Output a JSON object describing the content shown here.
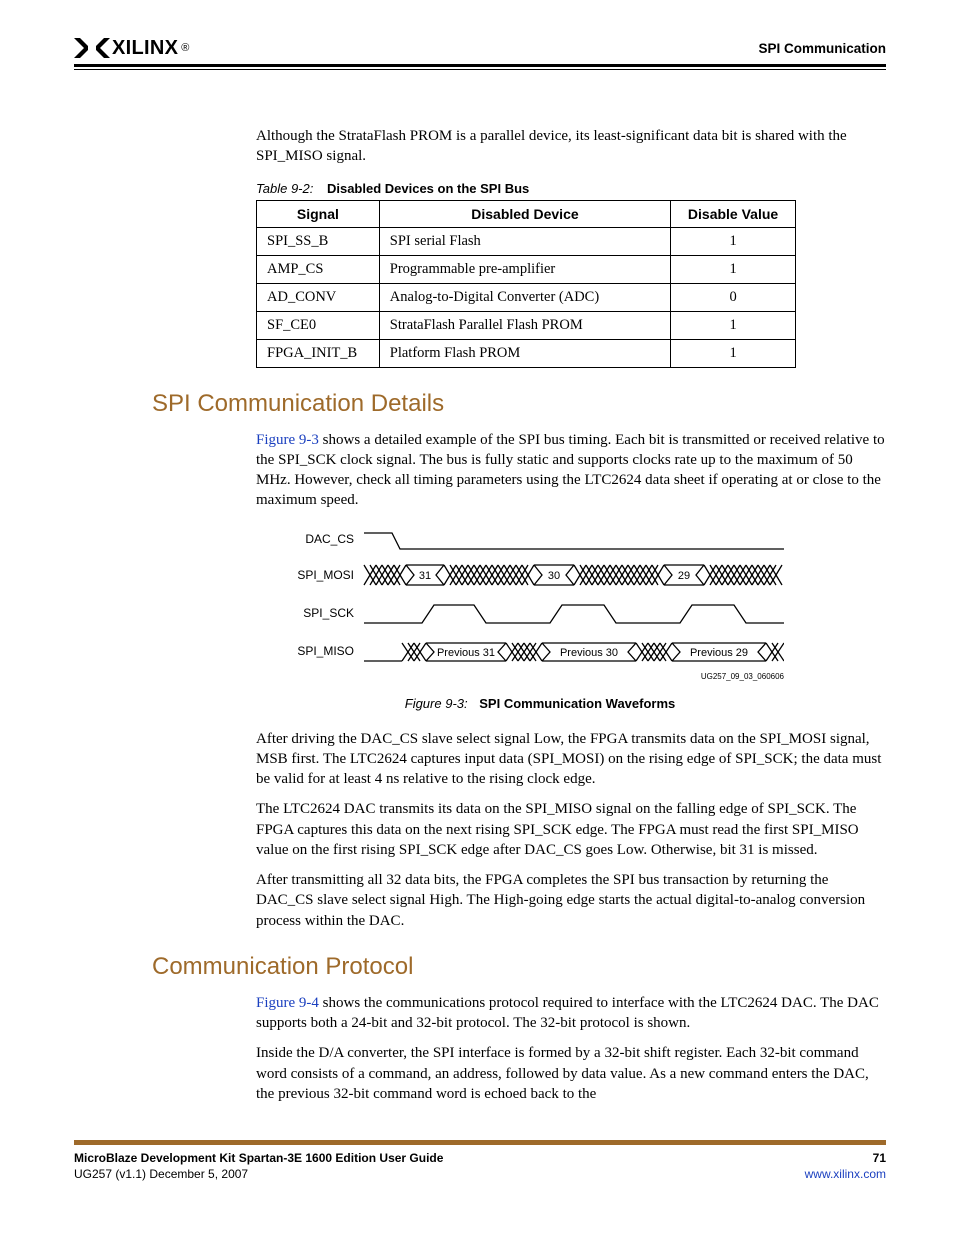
{
  "header": {
    "brand": "XILINX",
    "reg": "®",
    "section_title": "SPI Communication"
  },
  "intro_para": "Although the StrataFlash PROM is a parallel device, its least-significant data bit is shared with the SPI_MISO signal.",
  "table": {
    "caption_label": "Table 9-2:",
    "caption_title": "Disabled Devices on the SPI Bus",
    "headers": [
      "Signal",
      "Disabled Device",
      "Disable Value"
    ],
    "rows": [
      [
        "SPI_SS_B",
        "SPI serial Flash",
        "1"
      ],
      [
        "AMP_CS",
        "Programmable pre-amplifier",
        "1"
      ],
      [
        "AD_CONV",
        "Analog-to-Digital Converter (ADC)",
        "0"
      ],
      [
        "SF_CE0",
        "StrataFlash Parallel Flash PROM",
        "1"
      ],
      [
        "FPGA_INIT_B",
        "Platform Flash PROM",
        "1"
      ]
    ]
  },
  "section1": {
    "heading": "SPI Communication Details",
    "link_text": "Figure 9-3",
    "para1_rest": " shows a detailed example of the SPI bus timing. Each bit is transmitted or received relative to the SPI_SCK clock signal. The bus is fully static and supports clocks rate up to the maximum of 50 MHz. However, check all timing parameters using the LTC2624 data sheet if operating at or close to the maximum speed.",
    "figure": {
      "labels": [
        "DAC_CS",
        "SPI_MOSI",
        "SPI_SCK",
        "SPI_MISO"
      ],
      "mosi_bits": [
        "31",
        "30",
        "29"
      ],
      "miso_bits": [
        "Previous 31",
        "Previous 30",
        "Previous 29"
      ],
      "tagline": "UG257_09_03_060606",
      "caption_label": "Figure 9-3:",
      "caption_title": "SPI Communication Waveforms"
    },
    "para2": "After driving the DAC_CS slave select signal Low, the FPGA transmits data on the SPI_MOSI signal, MSB first. The LTC2624 captures input data (SPI_MOSI) on the rising edge of SPI_SCK; the data must be valid for at least 4 ns relative to the rising clock edge.",
    "para3": "The LTC2624 DAC transmits its data on the SPI_MISO signal on the falling edge of SPI_SCK. The FPGA captures this data on the next rising SPI_SCK edge. The FPGA must read the first SPI_MISO value on the first rising SPI_SCK edge after DAC_CS goes Low. Otherwise, bit 31 is missed.",
    "para4": "After transmitting all 32 data bits, the FPGA completes the SPI bus transaction by returning the DAC_CS slave select signal High. The High-going edge starts the actual digital-to-analog conversion process within the DAC."
  },
  "section2": {
    "heading": "Communication Protocol",
    "link_text": "Figure 9-4",
    "para1_rest": " shows the communications protocol required to interface with the LTC2624 DAC. The DAC supports both a 24-bit and 32-bit protocol. The 32-bit protocol is shown.",
    "para2": "Inside the D/A converter, the SPI interface is formed by a 32-bit shift register. Each 32-bit command word consists of a command, an address, followed by data value. As a new command enters the DAC, the previous 32-bit command word is echoed back to the"
  },
  "footer": {
    "title": "MicroBlaze Development Kit Spartan-3E 1600 Edition User Guide",
    "version": "UG257  (v1.1)  December 5, 2007",
    "page": "71",
    "url": "www.xilinx.com"
  }
}
